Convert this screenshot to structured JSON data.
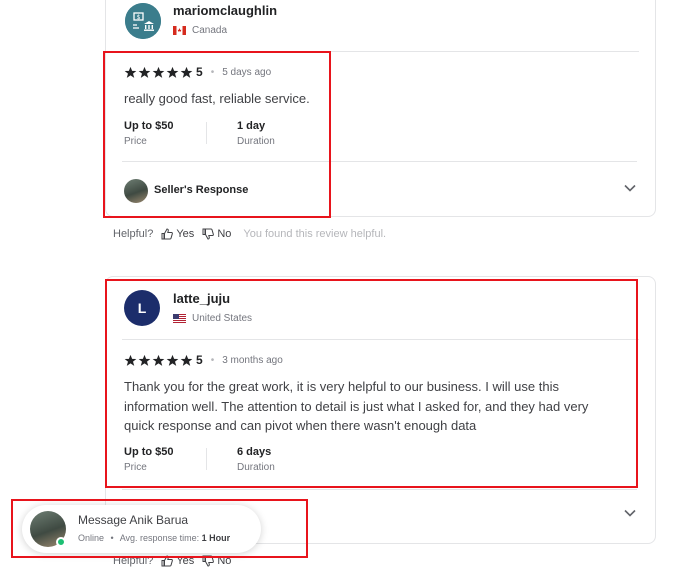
{
  "review1": {
    "username": "mariomclaughlin",
    "country": "Canada",
    "rating": "5",
    "time_ago": "5 days ago",
    "text": "really good fast, reliable service.",
    "price_value": "Up to $50",
    "price_label": "Price",
    "duration_value": "1 day",
    "duration_label": "Duration",
    "seller_response_label": "Seller's Response"
  },
  "helpful1": {
    "label": "Helpful?",
    "yes": "Yes",
    "no": "No",
    "note": "You found this review helpful."
  },
  "review2": {
    "avatar_letter": "L",
    "username": "latte_juju",
    "country": "United States",
    "rating": "5",
    "time_ago": "3 months ago",
    "text_lines": [
      "Thank you for the great work, it is very helpful to our business. I will use this",
      "information well. The attention to detail is just what I asked for, and they had very",
      "quick response and can pivot when there wasn't enough data"
    ],
    "price_value": "Up to $50",
    "price_label": "Price",
    "duration_value": "6 days",
    "duration_label": "Duration"
  },
  "helpful2": {
    "label": "Helpful?",
    "yes": "Yes",
    "no": "No"
  },
  "message_widget": {
    "title": "Message Anik Barua",
    "status": "Online",
    "separator": "•",
    "response_label": "Avg. response time:",
    "response_value": "1 Hour"
  },
  "colors": {
    "highlight_border": "#e8141c",
    "online": "#1dbf73",
    "avatar_navy": "#1c2d6b",
    "avatar_teal": "#3b7d8c"
  }
}
